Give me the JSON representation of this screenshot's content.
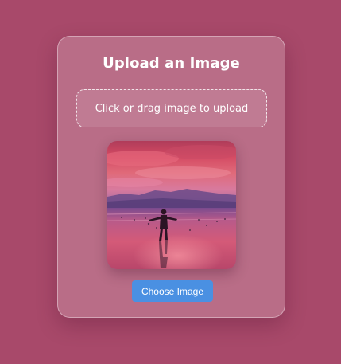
{
  "upload_card": {
    "title": "Upload an Image",
    "dropzone_text": "Click or drag image to upload",
    "choose_button_label": "Choose Image"
  },
  "preview": {
    "icon": "uploaded-photo-preview"
  },
  "colors": {
    "background": "#a8496a",
    "button": "#4a90e2",
    "text": "#ffffff"
  }
}
